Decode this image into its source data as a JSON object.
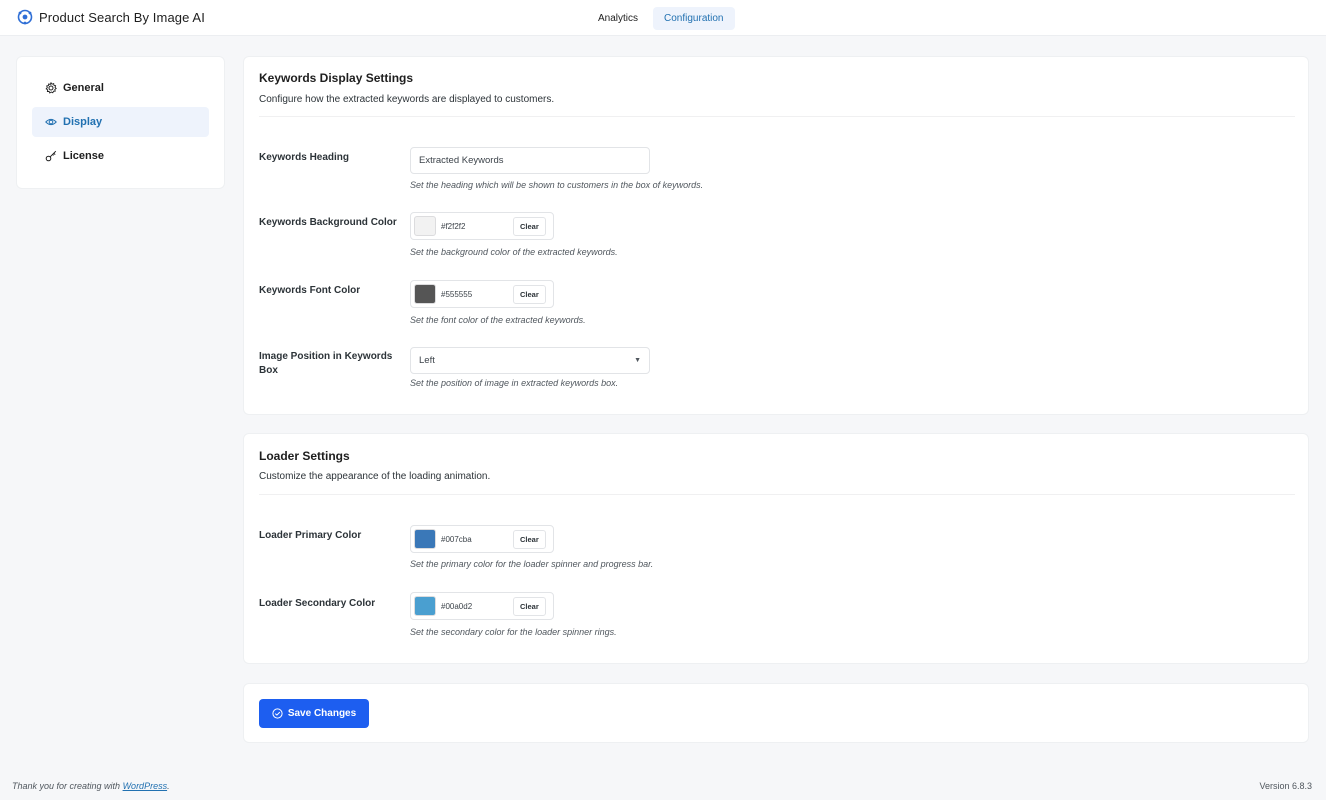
{
  "app": {
    "title": "Product Search By Image AI",
    "logo_icon": "ai-logo-icon"
  },
  "top_tabs": [
    {
      "label": "Analytics",
      "active": false
    },
    {
      "label": "Configuration",
      "active": true
    }
  ],
  "sidebar": {
    "items": [
      {
        "label": "General",
        "icon": "gear-icon",
        "active": false
      },
      {
        "label": "Display",
        "icon": "eye-icon",
        "active": true
      },
      {
        "label": "License",
        "icon": "key-icon",
        "active": false
      }
    ]
  },
  "keywords": {
    "title": "Keywords Display Settings",
    "description": "Configure how the extracted keywords are displayed to customers.",
    "heading": {
      "label": "Keywords Heading",
      "value": "Extracted Keywords",
      "help": "Set the heading which will be shown to customers in the box of keywords."
    },
    "bg_color": {
      "label": "Keywords Background Color",
      "value": "#f2f2f2",
      "swatch": "#f2f2f2",
      "clear": "Clear",
      "help": "Set the background color of the extracted keywords."
    },
    "font_color": {
      "label": "Keywords Font Color",
      "value": "#555555",
      "swatch": "#555555",
      "clear": "Clear",
      "help": "Set the font color of the extracted keywords."
    },
    "image_position": {
      "label": "Image Position in Keywords Box",
      "value": "Left",
      "help": "Set the position of image in extracted keywords box."
    }
  },
  "loader": {
    "title": "Loader Settings",
    "description": "Customize the appearance of the loading animation.",
    "primary": {
      "label": "Loader Primary Color",
      "value": "#007cba",
      "swatch": "#3a78b8",
      "clear": "Clear",
      "help": "Set the primary color for the loader spinner and progress bar."
    },
    "secondary": {
      "label": "Loader Secondary Color",
      "value": "#00a0d2",
      "swatch": "#4a9fd0",
      "clear": "Clear",
      "help": "Set the secondary color for the loader spinner rings."
    }
  },
  "actions": {
    "save_label": "Save Changes",
    "save_color": "#1d5ef0"
  },
  "footer": {
    "thanks_prefix": "Thank you for creating with ",
    "thanks_link": "WordPress",
    "thanks_suffix": ".",
    "version": "Version 6.8.3"
  }
}
